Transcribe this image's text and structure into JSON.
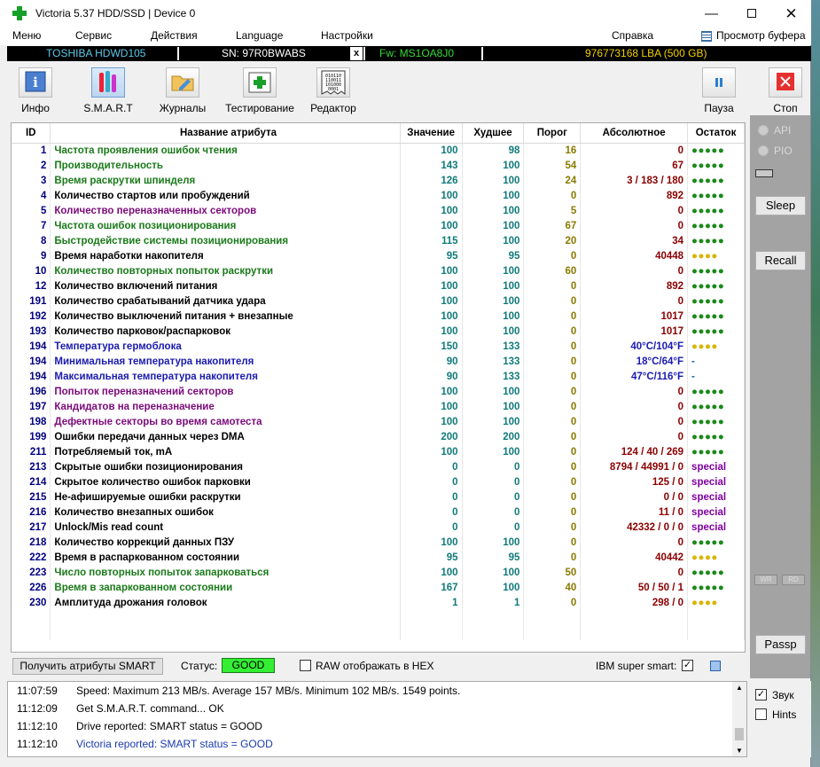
{
  "window": {
    "title": "Victoria 5.37 HDD/SSD | Device 0",
    "min": "—",
    "close": "✕"
  },
  "menu": {
    "items": [
      "Меню",
      "Сервис",
      "Действия",
      "Language",
      "Настройки",
      "Справка"
    ],
    "buffer": "Просмотр буфера"
  },
  "infobar": {
    "model": "TOSHIBA HDWD105",
    "serial": "SN: 97R0BWABS",
    "x": "x",
    "firmware": "Fw: MS1OA8J0",
    "capacity": "976773168 LBA (500 GB)"
  },
  "toolbar": {
    "info": "Инфо",
    "smart": "S.M.A.R.T",
    "logs": "Журналы",
    "test": "Тестирование",
    "editor": "Редактор",
    "pause": "Пауза",
    "stop": "Стоп",
    "editor_icon_text": "010110 110011 101000 0001"
  },
  "columns": {
    "id": "ID",
    "name": "Название атрибута",
    "value": "Значение",
    "worst": "Худшее",
    "threshold": "Порог",
    "raw": "Абсолютное",
    "remaining": "Остаток"
  },
  "colors": {
    "green": "#1a7a1a",
    "black": "#000000",
    "purple": "#7a0a7a",
    "blue": "#1a1ab0",
    "good": "#33ee33"
  },
  "rows": [
    {
      "id": "1",
      "name": "Частота проявления ошибок чтения",
      "color": "green",
      "value": "100",
      "worst": "98",
      "thr": "16",
      "raw": "0",
      "rem": "●●●●●",
      "remType": "green"
    },
    {
      "id": "2",
      "name": "Производительность",
      "color": "green",
      "value": "143",
      "worst": "100",
      "thr": "54",
      "raw": "67",
      "rem": "●●●●●",
      "remType": "green"
    },
    {
      "id": "3",
      "name": "Время раскрутки шпинделя",
      "color": "green",
      "value": "126",
      "worst": "100",
      "thr": "24",
      "raw": "3 / 183 / 180",
      "rem": "●●●●●",
      "remType": "green"
    },
    {
      "id": "4",
      "name": "Количество стартов или пробуждений",
      "color": "black",
      "value": "100",
      "worst": "100",
      "thr": "0",
      "raw": "892",
      "rem": "●●●●●",
      "remType": "green"
    },
    {
      "id": "5",
      "name": "Количество переназначенных секторов",
      "color": "purple",
      "value": "100",
      "worst": "100",
      "thr": "5",
      "raw": "0",
      "rem": "●●●●●",
      "remType": "green"
    },
    {
      "id": "7",
      "name": "Частота ошибок позиционирования",
      "color": "green",
      "value": "100",
      "worst": "100",
      "thr": "67",
      "raw": "0",
      "rem": "●●●●●",
      "remType": "green"
    },
    {
      "id": "8",
      "name": "Быстродействие системы позиционирования",
      "color": "green",
      "value": "115",
      "worst": "100",
      "thr": "20",
      "raw": "34",
      "rem": "●●●●●",
      "remType": "green"
    },
    {
      "id": "9",
      "name": "Время наработки накопителя",
      "color": "black",
      "value": "95",
      "worst": "95",
      "thr": "0",
      "raw": "40448",
      "rem": "●●●●",
      "remType": "yellow"
    },
    {
      "id": "10",
      "name": "Количество повторных попыток раскрутки",
      "color": "green",
      "value": "100",
      "worst": "100",
      "thr": "60",
      "raw": "0",
      "rem": "●●●●●",
      "remType": "green"
    },
    {
      "id": "12",
      "name": "Количество включений питания",
      "color": "black",
      "value": "100",
      "worst": "100",
      "thr": "0",
      "raw": "892",
      "rem": "●●●●●",
      "remType": "green"
    },
    {
      "id": "191",
      "name": "Количество срабатываний датчика удара",
      "color": "black",
      "value": "100",
      "worst": "100",
      "thr": "0",
      "raw": "0",
      "rem": "●●●●●",
      "remType": "green"
    },
    {
      "id": "192",
      "name": "Количество выключений питания + внезапные",
      "color": "black",
      "value": "100",
      "worst": "100",
      "thr": "0",
      "raw": "1017",
      "rem": "●●●●●",
      "remType": "green"
    },
    {
      "id": "193",
      "name": "Количество парковок/распарковок",
      "color": "black",
      "value": "100",
      "worst": "100",
      "thr": "0",
      "raw": "1017",
      "rem": "●●●●●",
      "remType": "green"
    },
    {
      "id": "194",
      "name": "Температура гермоблока",
      "color": "blue",
      "value": "150",
      "worst": "133",
      "thr": "0",
      "raw": "40°C/104°F",
      "rem": "●●●●",
      "remType": "yellow",
      "rawBlue": true
    },
    {
      "id": "194",
      "name": "Минимальная температура накопителя",
      "color": "blue",
      "value": "90",
      "worst": "133",
      "thr": "0",
      "raw": "18°C/64°F",
      "rem": "-",
      "remType": "dash",
      "rawBlue": true
    },
    {
      "id": "194",
      "name": "Максимальная температура накопителя",
      "color": "blue",
      "value": "90",
      "worst": "133",
      "thr": "0",
      "raw": "47°C/116°F",
      "rem": "-",
      "remType": "dash",
      "rawBlue": true
    },
    {
      "id": "196",
      "name": "Попыток переназначений секторов",
      "color": "purple",
      "value": "100",
      "worst": "100",
      "thr": "0",
      "raw": "0",
      "rem": "●●●●●",
      "remType": "green"
    },
    {
      "id": "197",
      "name": "Кандидатов на переназначение",
      "color": "purple",
      "value": "100",
      "worst": "100",
      "thr": "0",
      "raw": "0",
      "rem": "●●●●●",
      "remType": "green"
    },
    {
      "id": "198",
      "name": "Дефектные секторы во время самотеста",
      "color": "purple",
      "value": "100",
      "worst": "100",
      "thr": "0",
      "raw": "0",
      "rem": "●●●●●",
      "remType": "green"
    },
    {
      "id": "199",
      "name": "Ошибки передачи данных через DMA",
      "color": "black",
      "value": "200",
      "worst": "200",
      "thr": "0",
      "raw": "0",
      "rem": "●●●●●",
      "remType": "green"
    },
    {
      "id": "211",
      "name": "Потребляемый ток, mA",
      "color": "black",
      "value": "100",
      "worst": "100",
      "thr": "0",
      "raw": "124 / 40 / 269",
      "rem": "●●●●●",
      "remType": "green"
    },
    {
      "id": "213",
      "name": "Скрытые ошибки позиционирования",
      "color": "black",
      "value": "0",
      "worst": "0",
      "thr": "0",
      "raw": "8794 / 44991 / 0",
      "rem": "special",
      "remType": "special"
    },
    {
      "id": "214",
      "name": "Скрытое количество ошибок парковки",
      "color": "black",
      "value": "0",
      "worst": "0",
      "thr": "0",
      "raw": "125 / 0",
      "rem": "special",
      "remType": "special"
    },
    {
      "id": "215",
      "name": "Не-афишируемые ошибки раскрутки",
      "color": "black",
      "value": "0",
      "worst": "0",
      "thr": "0",
      "raw": "0 / 0",
      "rem": "special",
      "remType": "special"
    },
    {
      "id": "216",
      "name": "Количество внезапных ошибок",
      "color": "black",
      "value": "0",
      "worst": "0",
      "thr": "0",
      "raw": "11 / 0",
      "rem": "special",
      "remType": "special"
    },
    {
      "id": "217",
      "name": "Unlock/Mis read count",
      "color": "black",
      "value": "0",
      "worst": "0",
      "thr": "0",
      "raw": "42332 / 0 / 0",
      "rem": "special",
      "remType": "special"
    },
    {
      "id": "218",
      "name": "Количество коррекций данных ПЗУ",
      "color": "black",
      "value": "100",
      "worst": "100",
      "thr": "0",
      "raw": "0",
      "rem": "●●●●●",
      "remType": "green"
    },
    {
      "id": "222",
      "name": "Время в распаркованном состоянии",
      "color": "black",
      "value": "95",
      "worst": "95",
      "thr": "0",
      "raw": "40442",
      "rem": "●●●●",
      "remType": "yellow"
    },
    {
      "id": "223",
      "name": "Число повторных попыток запарковаться",
      "color": "green",
      "value": "100",
      "worst": "100",
      "thr": "50",
      "raw": "0",
      "rem": "●●●●●",
      "remType": "green"
    },
    {
      "id": "226",
      "name": "Время в запаркованном состоянии",
      "color": "green",
      "value": "167",
      "worst": "100",
      "thr": "40",
      "raw": "50 / 50 / 1",
      "rem": "●●●●●",
      "remType": "green"
    },
    {
      "id": "230",
      "name": "Амплитуда дрожания головок",
      "color": "black",
      "value": "1",
      "worst": "1",
      "thr": "0",
      "raw": "298 / 0",
      "rem": "●●●●",
      "remType": "yellow"
    }
  ],
  "status": {
    "get_smart": "Получить атрибуты SMART",
    "status_label": "Статус:",
    "status_value": "GOOD",
    "raw_hex": "RAW отображать в HEX",
    "ibm_smart": "IBM super smart:",
    "check": "✓"
  },
  "right_panel": {
    "api": "API",
    "pio": "PIO",
    "sleep": "Sleep",
    "recall": "Recall",
    "passp": "Passp",
    "mini1": "WR",
    "mini2": "RD"
  },
  "log": [
    {
      "time": "11:07:59",
      "msg": "Speed: Maximum 213 MB/s. Average 157 MB/s. Minimum 102 MB/s. 1549 points.",
      "blue": false
    },
    {
      "time": "11:12:09",
      "msg": "Get S.M.A.R.T. command... OK",
      "blue": false
    },
    {
      "time": "11:12:10",
      "msg": "Drive reported: SMART status = GOOD",
      "blue": false
    },
    {
      "time": "11:12:10",
      "msg": "Victoria reported: SMART status = GOOD",
      "blue": true
    }
  ],
  "options": {
    "sound": "Звук",
    "hints": "Hints",
    "sound_checked": "✓"
  }
}
